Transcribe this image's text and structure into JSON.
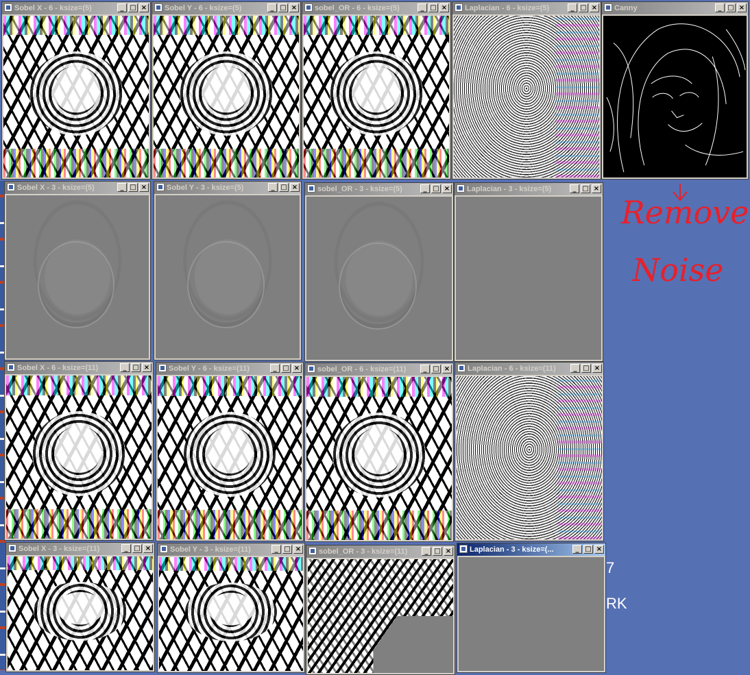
{
  "windows": [
    {
      "title": "Sobel X - 6 - ksize=(5)",
      "image": "sobel",
      "active": false
    },
    {
      "title": "Sobel Y - 6 - ksize=(5)",
      "image": "sobel",
      "active": false
    },
    {
      "title": "sobel_OR - 6 - ksize=(5)",
      "image": "sobel",
      "active": false
    },
    {
      "title": "Laplacian - 6 - ksize=(5)",
      "image": "laplacian",
      "active": false
    },
    {
      "title": "Canny",
      "image": "canny",
      "active": false
    },
    {
      "title": "Sobel X - 3 - ksize=(5)",
      "image": "gray-relief",
      "active": false
    },
    {
      "title": "Sobel Y - 3 - ksize=(5)",
      "image": "gray-relief",
      "active": false
    },
    {
      "title": "sobel_OR - 3 - ksize=(5)",
      "image": "gray-relief",
      "active": false
    },
    {
      "title": "Laplacian - 3 - ksize=(5)",
      "image": "flat-gray",
      "active": false
    },
    {
      "title": "Sobel X - 6 - ksize=(11)",
      "image": "sobel",
      "active": false
    },
    {
      "title": "Sobel Y - 6 - ksize=(11)",
      "image": "sobel",
      "active": false
    },
    {
      "title": "sobel_OR - 6 - ksize=(11)",
      "image": "sobel",
      "active": false
    },
    {
      "title": "Laplacian - 6 - ksize=(11)",
      "image": "laplacian",
      "active": false
    },
    {
      "title": "Sobel X - 3 - ksize=(11)",
      "image": "sobel",
      "active": false
    },
    {
      "title": "Sobel Y - 3 - ksize=(11)",
      "image": "sobel",
      "active": false
    },
    {
      "title": "sobel_OR - 3 - ksize=(11)",
      "image": "mixed",
      "active": false
    },
    {
      "title": "Laplacian - 3 - ksize=(...",
      "image": "flat-gray",
      "active": true
    }
  ],
  "title_buttons": {
    "minimize": "_",
    "maximize": "□",
    "close": "×"
  },
  "annotation": {
    "line1": "Remove",
    "line2": "Noise",
    "color": "#e8202a"
  },
  "desktop_fragments": {
    "a": "7",
    "b": "RK"
  },
  "colors": {
    "desktop": "#5670b4",
    "window_face": "#d4d0c8",
    "active_title": "#0a246a",
    "inactive_title": "#808080"
  }
}
